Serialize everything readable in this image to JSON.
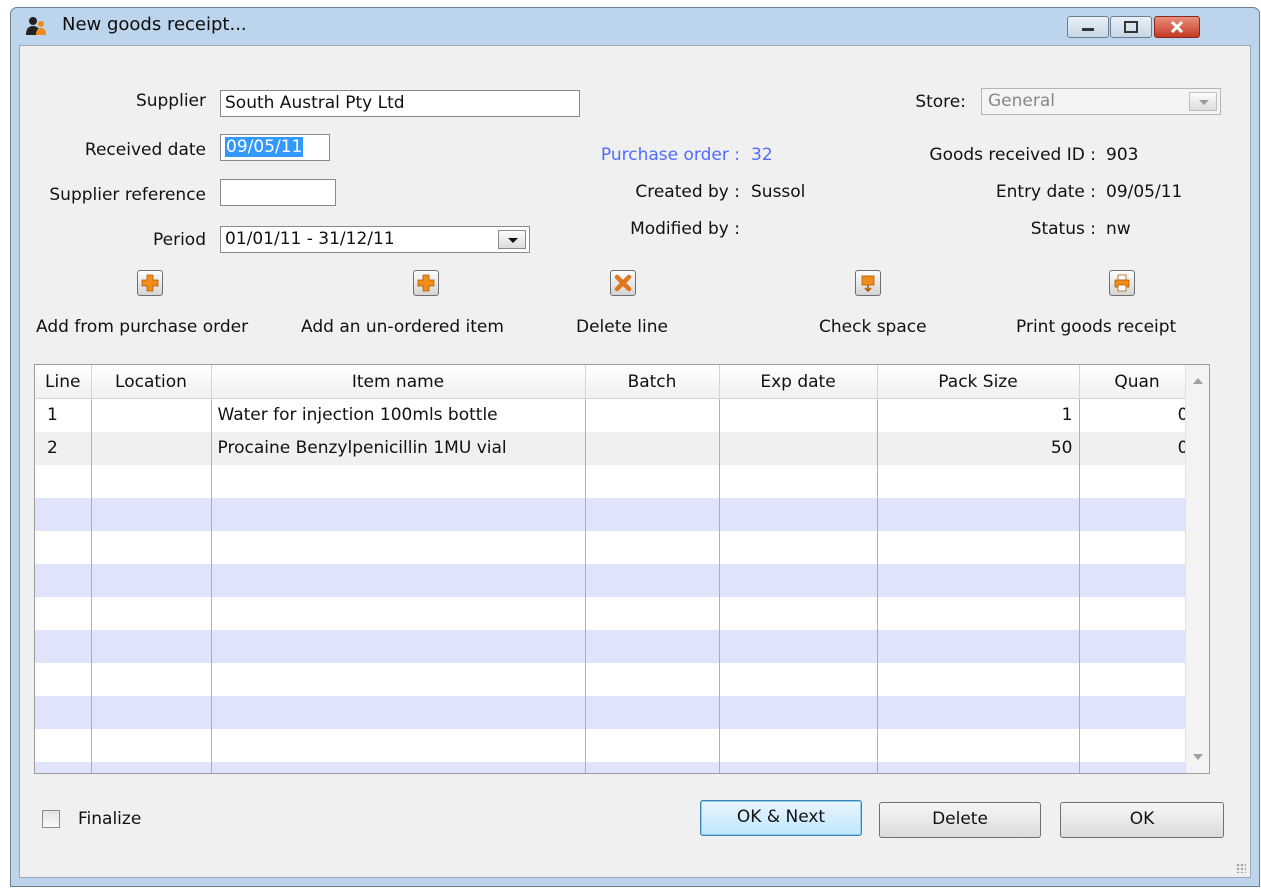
{
  "window": {
    "title": "New goods receipt..."
  },
  "form": {
    "supplier_label": "Supplier",
    "supplier_value": "South Austral Pty Ltd",
    "received_date_label": "Received date",
    "received_date_value": "09/05/11",
    "supplier_reference_label": "Supplier reference",
    "supplier_reference_value": "",
    "period_label": "Period",
    "period_value": "01/01/11 - 31/12/11"
  },
  "info": {
    "purchase_order_label": "Purchase order :",
    "purchase_order_value": "32",
    "created_by_label": "Created by :",
    "created_by_value": "Sussol",
    "modified_by_label": "Modified by :",
    "modified_by_value": "",
    "store_label": "Store:",
    "store_value": "General",
    "goods_received_id_label": "Goods received ID :",
    "goods_received_id_value": "903",
    "entry_date_label": "Entry date :",
    "entry_date_value": "09/05/11",
    "status_label": "Status :",
    "status_value": "nw"
  },
  "toolbar": {
    "add_from_po": "Add from purchase order",
    "add_unordered": "Add an un-ordered item",
    "delete_line": "Delete line",
    "check_space": "Check space",
    "print_receipt": "Print goods receipt"
  },
  "table": {
    "columns": [
      "Line",
      "Location",
      "Item name",
      "Batch",
      "Exp date",
      "Pack Size",
      "Quan"
    ],
    "rows": [
      {
        "line": "1",
        "location": "",
        "item_name": "Water for injection 100mls bottle",
        "batch": "",
        "exp_date": "",
        "pack_size": "1",
        "quantity": "0"
      },
      {
        "line": "2",
        "location": "",
        "item_name": "Procaine Benzylpenicillin 1MU vial",
        "batch": "",
        "exp_date": "",
        "pack_size": "50",
        "quantity": "0"
      }
    ]
  },
  "footer": {
    "finalize_label": "Finalize",
    "ok_next": "OK & Next",
    "delete": "Delete",
    "ok": "OK"
  },
  "colors": {
    "accent_blue_text": "#4f6cff",
    "row_alt": "#dfe4fb",
    "selection": "#3399ff",
    "toolbar_icon": "#f08c1a",
    "delete_icon": "#e07820"
  },
  "icons": {
    "window": "users-icon",
    "add_from_po": "plus-icon",
    "add_unordered": "plus-icon",
    "delete_line": "x-icon",
    "check_space": "box-arrow-icon",
    "print_receipt": "printer-icon"
  }
}
